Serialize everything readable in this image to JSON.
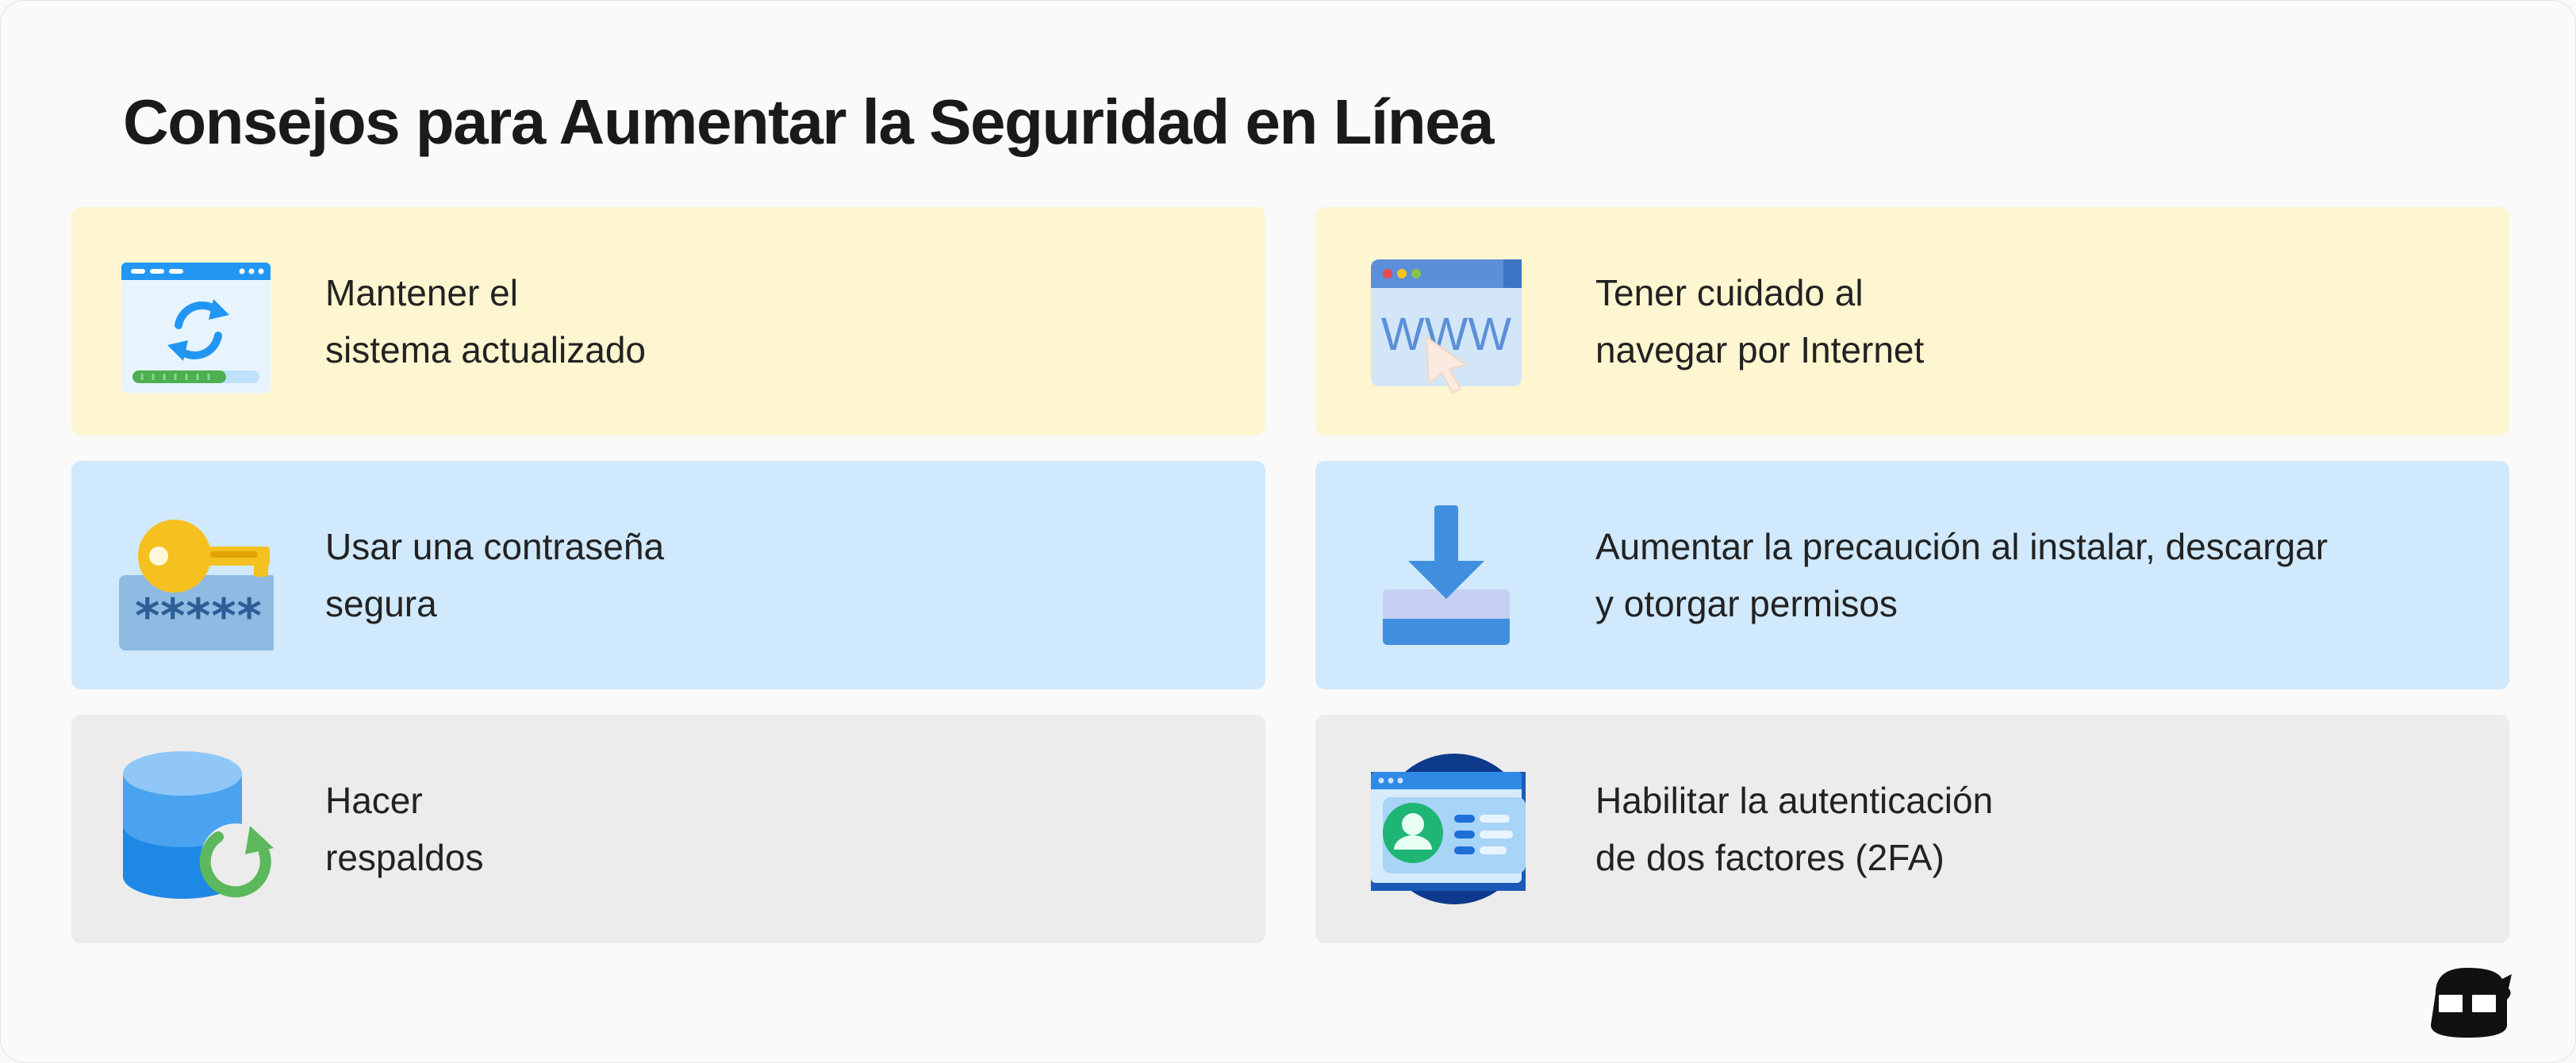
{
  "title": "Consejos para Aumentar la Seguridad en Línea",
  "cards": [
    {
      "line1": "Mantener el",
      "line2": "sistema actualizado",
      "icon": "update-window-icon"
    },
    {
      "line1": "Tener cuidado al",
      "line2": "navegar por Internet",
      "icon": "www-browser-icon"
    },
    {
      "line1": "Usar una contraseña",
      "line2": "segura",
      "icon": "key-password-icon",
      "icon_text": "*****"
    },
    {
      "line1": "Aumentar la precaución al instalar, descargar",
      "line2": "y otorgar permisos",
      "icon": "download-tray-icon"
    },
    {
      "line1": "Hacer",
      "line2": "respaldos",
      "icon": "database-backup-icon"
    },
    {
      "line1": "Habilitar la autenticación",
      "line2": "de dos factores (2FA)",
      "icon": "identity-card-icon"
    }
  ],
  "www_text": "WWW",
  "colors": {
    "yellow_card": "#fdf6d0",
    "blue_card": "#d0e9fc",
    "gray_card": "#ececec"
  }
}
